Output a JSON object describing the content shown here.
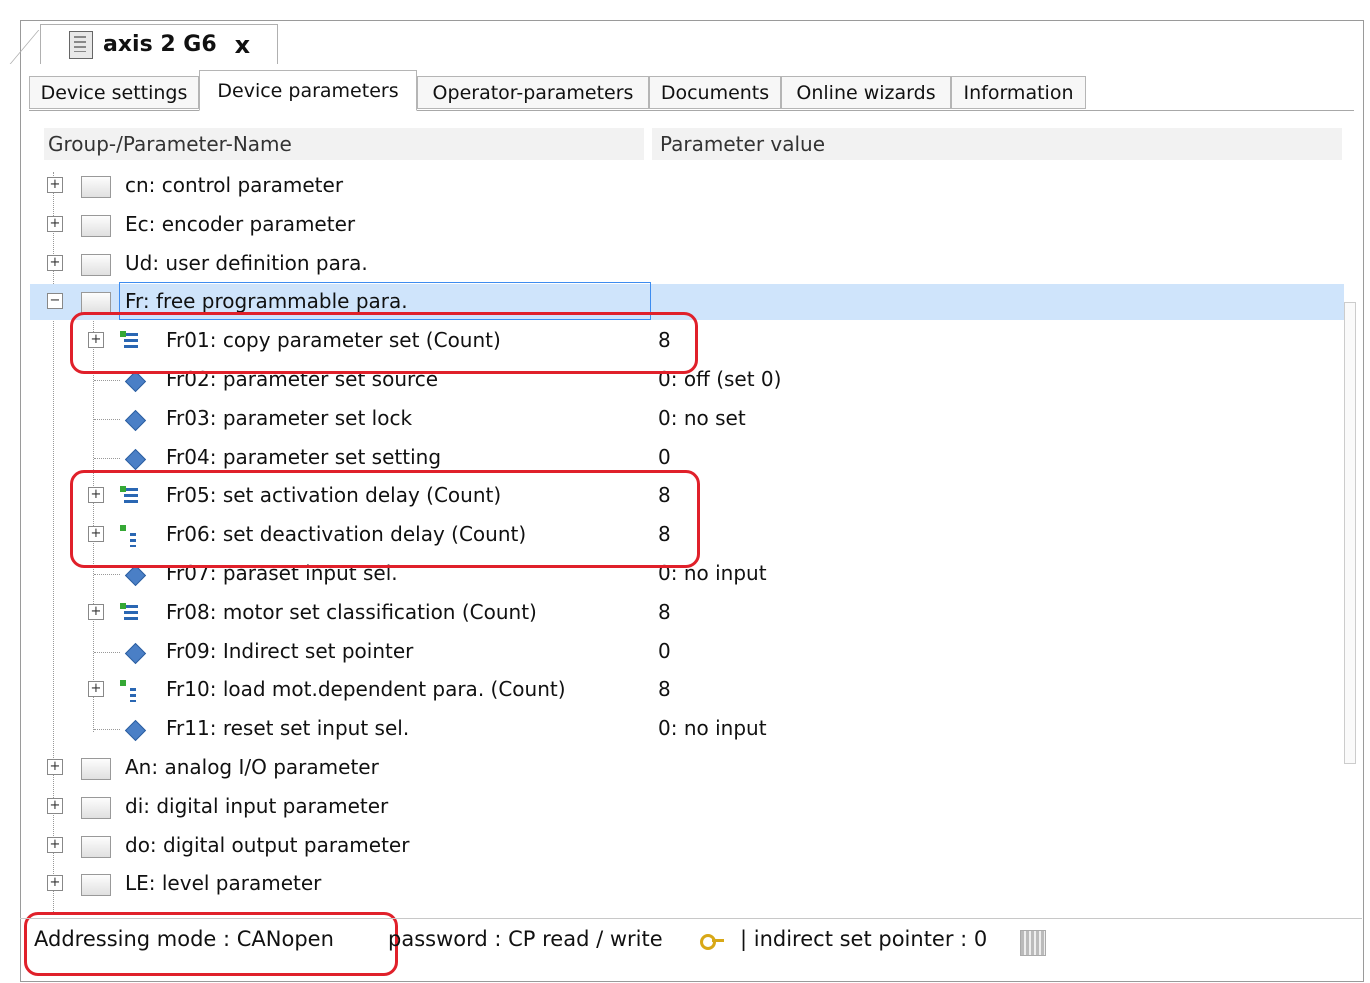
{
  "window": {
    "doc_tab_title": "axis  2  G6",
    "doc_tab_close": "x"
  },
  "tabs": [
    {
      "label": "Device settings",
      "active": false
    },
    {
      "label": "Device parameters",
      "active": true
    },
    {
      "label": "Operator-parameters",
      "active": false
    },
    {
      "label": "Documents",
      "active": false
    },
    {
      "label": "Online wizards",
      "active": false
    },
    {
      "label": "Information",
      "active": false
    }
  ],
  "table": {
    "col_name": "Group-/Parameter-Name",
    "col_value": "Parameter value"
  },
  "rows": [
    {
      "label": "cn: control parameter",
      "value": "",
      "kind": "group",
      "expander": "+"
    },
    {
      "label": "Ec: encoder parameter",
      "value": "",
      "kind": "group",
      "expander": "+"
    },
    {
      "label": "Ud: user definition para.",
      "value": "",
      "kind": "group",
      "expander": "+"
    },
    {
      "label": "Fr: free programmable para.",
      "value": "",
      "kind": "group",
      "expander": "−",
      "selected": true
    },
    {
      "label": "Fr01: copy parameter set (Count)",
      "value": "8",
      "kind": "array",
      "expander": "+"
    },
    {
      "label": "Fr02: parameter set source",
      "value": "0: off (set 0)",
      "kind": "param"
    },
    {
      "label": "Fr03: parameter set lock",
      "value": "0: no set",
      "kind": "param"
    },
    {
      "label": "Fr04: parameter set setting",
      "value": "0",
      "kind": "param"
    },
    {
      "label": "Fr05: set activation delay (Count)",
      "value": "8",
      "kind": "array",
      "expander": "+"
    },
    {
      "label": "Fr06: set deactivation delay (Count)",
      "value": "8",
      "kind": "array2",
      "expander": "+"
    },
    {
      "label": "Fr07: paraset input sel.",
      "value": "0: no input",
      "kind": "param"
    },
    {
      "label": "Fr08: motor set classification (Count)",
      "value": "8",
      "kind": "array",
      "expander": "+"
    },
    {
      "label": "Fr09: Indirect set pointer",
      "value": "0",
      "kind": "param"
    },
    {
      "label": "Fr10: load mot.dependent para. (Count)",
      "value": "8",
      "kind": "array2",
      "expander": "+"
    },
    {
      "label": "Fr11: reset set input sel.",
      "value": "0: no input",
      "kind": "param"
    },
    {
      "label": "An: analog I/O parameter",
      "value": "",
      "kind": "group",
      "expander": "+"
    },
    {
      "label": "di: digital input parameter",
      "value": "",
      "kind": "group",
      "expander": "+"
    },
    {
      "label": "do: digital output parameter",
      "value": "",
      "kind": "group",
      "expander": "+"
    },
    {
      "label": "LE: level parameter",
      "value": "",
      "kind": "group",
      "expander": "+"
    }
  ],
  "status": {
    "addressing": "Addressing mode  : CANopen",
    "password": "password : CP read / write",
    "indirect": "| indirect set pointer  : 0"
  },
  "colors": {
    "highlight": "#e0202a",
    "selection": "#cfe4fb"
  }
}
